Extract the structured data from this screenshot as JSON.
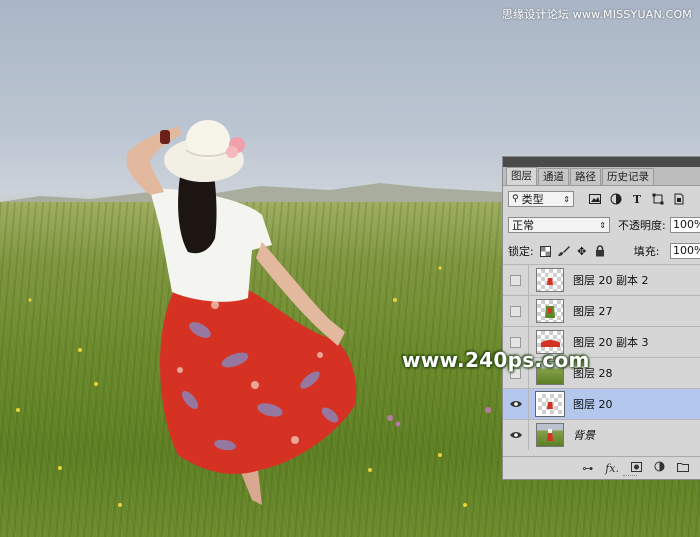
{
  "watermark_top": "思缘设计论坛 www.MISSYUAN.COM",
  "watermark_center": "www.240ps.com",
  "panel": {
    "tabs": [
      "图层",
      "通道",
      "路径",
      "历史记录"
    ],
    "active_tab": "图层",
    "filter_label": "类型",
    "blend_mode": "正常",
    "opacity_label": "不透明度:",
    "opacity_value": "100%",
    "lock_label": "锁定:",
    "fill_label": "填充:",
    "fill_value": "100%",
    "layers": [
      {
        "name": "图层 20 副本 2",
        "visible": false,
        "active": false
      },
      {
        "name": "图层 27",
        "visible": false,
        "active": false
      },
      {
        "name": "图层 20 副本 3",
        "visible": false,
        "active": false
      },
      {
        "name": "图层 28",
        "visible": false,
        "active": false
      },
      {
        "name": "图层 20",
        "visible": true,
        "active": true
      },
      {
        "name": "背景",
        "visible": true,
        "active": false
      }
    ]
  },
  "colors": {
    "panel_bg": "#d6d6d6",
    "active_layer": "#b4c8ee",
    "skirt_red": "#d63224"
  }
}
